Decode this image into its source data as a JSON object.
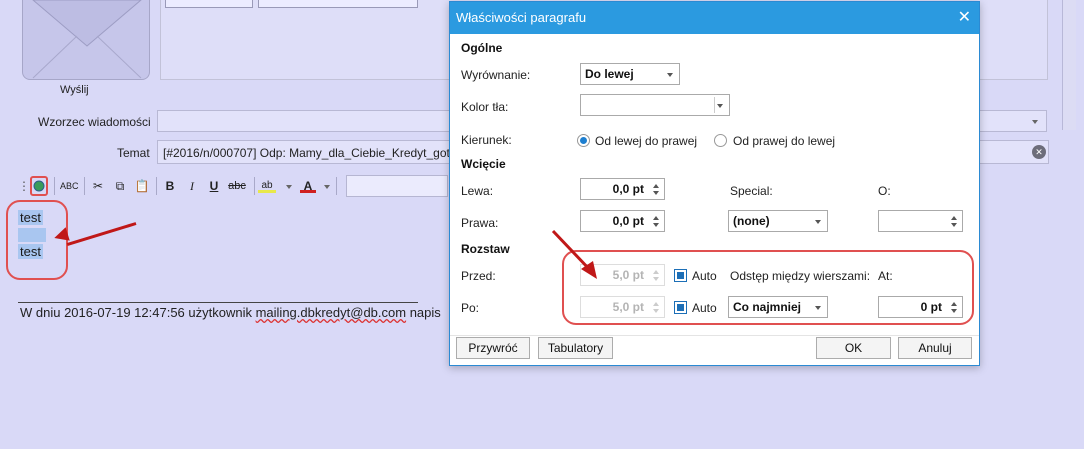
{
  "background": {
    "send_label": "Wyślij",
    "template_label": "Wzorzec wiadomości",
    "subject_label": "Temat",
    "subject_value": "[#2016/n/000707] Odp: Mamy_dla_Ciebie_Kredyt_gotó",
    "body_line1": "test",
    "body_line2": "test",
    "quote_prefix": "W dniu 2016-07-19 12:47:56 użytkownik ",
    "quote_email": "mailing.dbkredyt@db.com",
    "quote_suffix": " napis",
    "toolbar": {
      "bold": "B",
      "italic": "I",
      "underline": "U",
      "strike": "abc",
      "highlight": "ab",
      "font_color": "A"
    }
  },
  "dialog": {
    "title": "Właściwości paragrafu",
    "close": "✕",
    "section_general": "Ogólne",
    "alignment_label": "Wyrównanie:",
    "alignment_value": "Do lewej",
    "bg_color_label": "Kolor tła:",
    "bg_color_value": "",
    "direction_label": "Kierunek:",
    "direction_ltr": "Od lewej do prawej",
    "direction_rtl": "Od prawej do lewej",
    "direction_selected": "ltr",
    "section_indent": "Wcięcie",
    "left_label": "Lewa:",
    "left_value": "0,0 pt",
    "right_label": "Prawa:",
    "right_value": "0,0 pt",
    "special_label": "Special:",
    "special_value": "(none)",
    "o_label": "O:",
    "o_value": "",
    "section_spacing": "Rozstaw",
    "before_label": "Przed:",
    "before_value": "5,0 pt",
    "before_auto_label": "Auto",
    "before_auto_checked": true,
    "after_label": "Po:",
    "after_value": "5,0 pt",
    "after_auto_label": "Auto",
    "after_auto_checked": true,
    "line_spacing_label": "Odstęp między wierszami:",
    "line_spacing_value": "Co najmniej",
    "at_label": "At:",
    "at_value": "0 pt",
    "reset_button": "Przywróć",
    "tabs_button": "Tabulatory",
    "ok_button": "OK",
    "cancel_button": "Anuluj"
  },
  "colors": {
    "titlebar": "#2b9ae0",
    "annotation_red": "#c01818",
    "background_window": "#d9d9f7"
  }
}
